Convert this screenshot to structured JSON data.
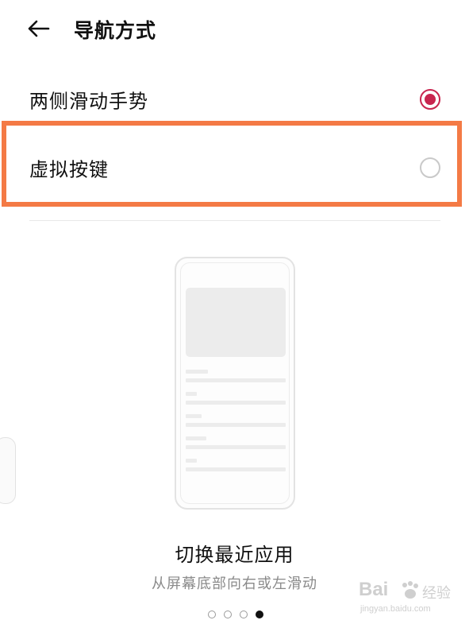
{
  "header": {
    "title": "导航方式"
  },
  "options": [
    {
      "label": "两侧滑动手势",
      "selected": true
    },
    {
      "label": "虚拟按键",
      "selected": false
    }
  ],
  "illustration": {
    "caption_title": "切换最近应用",
    "caption_subtitle": "从屏幕底部向右或左滑动"
  },
  "pager": {
    "total": 4,
    "current": 4
  },
  "watermark": {
    "brand": "Bai",
    "brand_cn": "经验",
    "url": "jingyan.baidu.com"
  },
  "colors": {
    "accent": "#c8254f",
    "highlight_frame": "#f47a45"
  }
}
